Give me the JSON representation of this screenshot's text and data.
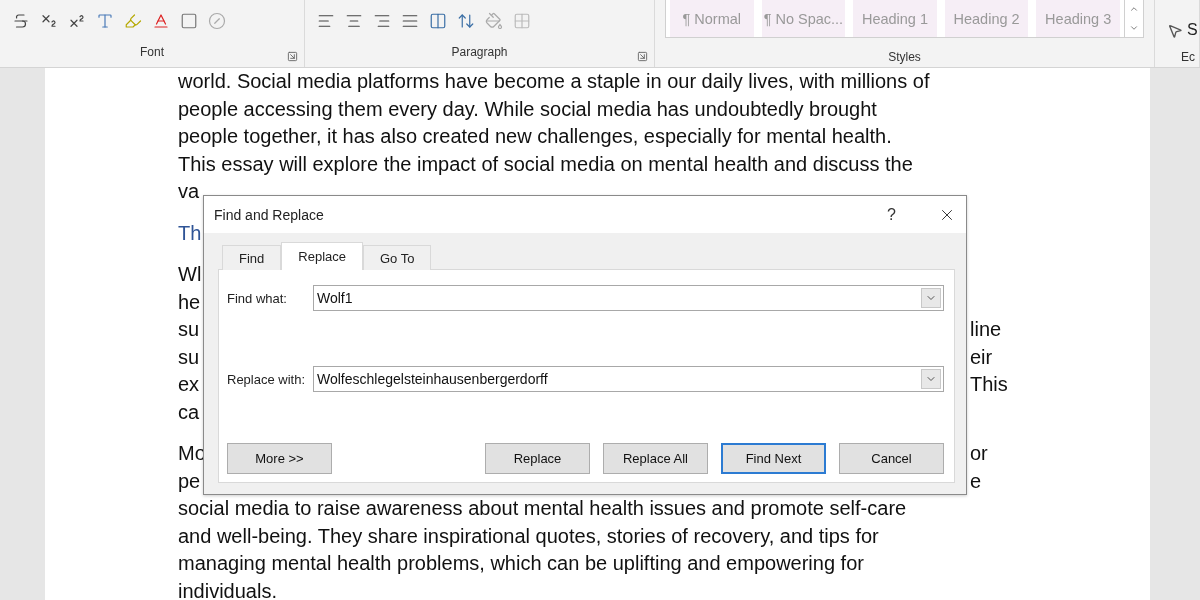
{
  "ribbon": {
    "groups": [
      {
        "label": "Font"
      },
      {
        "label": "Paragraph"
      },
      {
        "label": "Styles"
      },
      {
        "label": "Ec"
      }
    ],
    "styles": [
      {
        "label": "¶ Normal"
      },
      {
        "label": "¶ No Spac..."
      },
      {
        "label": "Heading 1"
      },
      {
        "label": "Heading 2"
      },
      {
        "label": "Heading 3"
      }
    ],
    "editing_item": "S"
  },
  "document": {
    "paragraphs": [
      {
        "kind": "body",
        "lines": [
          {
            "left": "world. Social media platforms have become a staple in our daily lives, with millions of"
          },
          {
            "left": "people accessing them every day. While social media has undoubtedly brought"
          },
          {
            "left": "people together, it has also created new challenges, especially for mental health."
          },
          {
            "left": "This essay will explore the impact of social media on mental health and discuss the"
          },
          {
            "left": "va"
          }
        ]
      },
      {
        "kind": "heading",
        "lines": [
          {
            "left": "Th"
          }
        ]
      },
      {
        "kind": "body",
        "lines": [
          {
            "left": "Wl"
          },
          {
            "left": "he"
          },
          {
            "left": "su",
            "right": "line"
          },
          {
            "left": "su",
            "right": "eir"
          },
          {
            "left": "ex",
            "right": "This"
          },
          {
            "left": "ca"
          }
        ]
      },
      {
        "kind": "body",
        "lines": [
          {
            "left": "Mo",
            "right": "or"
          },
          {
            "left": "pe",
            "right": "e"
          },
          {
            "left": "social media to raise awareness about mental health issues and promote self-care"
          },
          {
            "left": "and well-being. They share inspirational quotes, stories of recovery, and tips for"
          },
          {
            "left": "managing mental health problems, which can be uplifting and empowering for"
          },
          {
            "left": "individuals."
          }
        ]
      }
    ]
  },
  "dialog": {
    "title": "Find and Replace",
    "help": "?",
    "tabs": [
      {
        "label": "Find",
        "selected": false
      },
      {
        "label": "Replace",
        "selected": true
      },
      {
        "label": "Go To",
        "selected": false
      }
    ],
    "fields": [
      {
        "label": "Find what:",
        "value": "Wolf1"
      },
      {
        "label": "Replace with:",
        "value": "Wolfeschlegelsteinhausenbergerdorff"
      }
    ],
    "buttons": [
      {
        "label": "More >>",
        "default": false
      },
      {
        "label": "Replace",
        "default": false
      },
      {
        "label": "Replace All",
        "default": false
      },
      {
        "label": "Find Next",
        "default": true
      },
      {
        "label": "Cancel",
        "default": false
      }
    ]
  }
}
